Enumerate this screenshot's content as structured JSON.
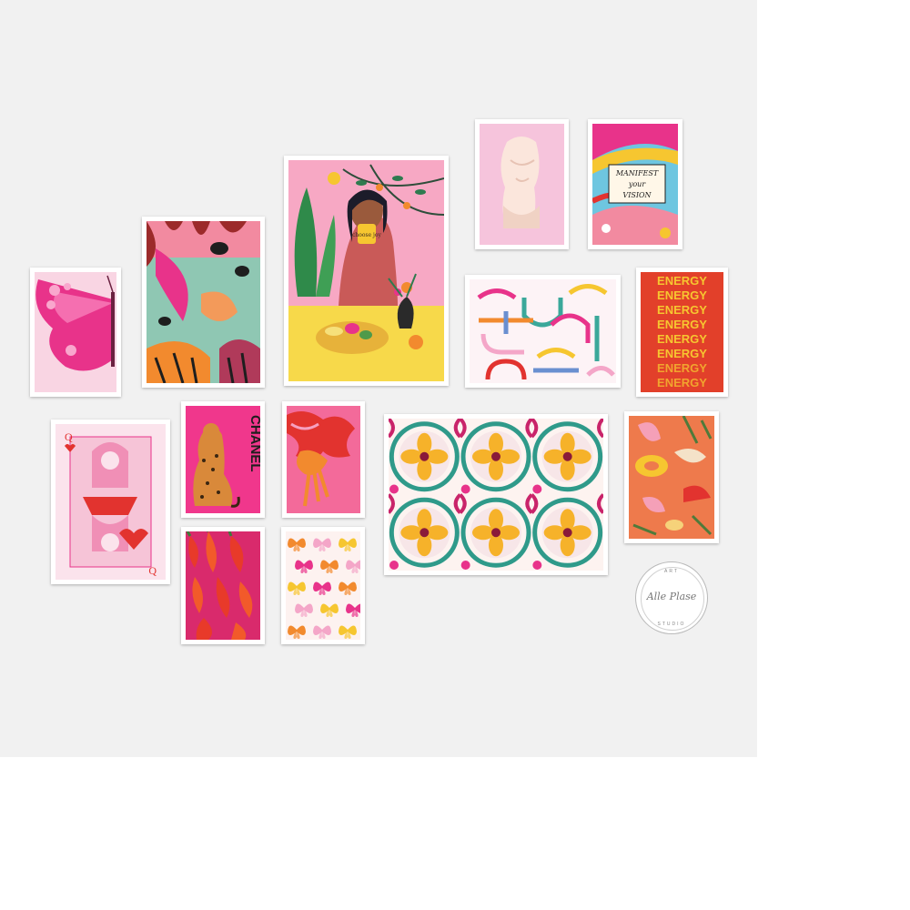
{
  "image": {
    "description_free": true,
    "background": "#f1f1f1",
    "frame_color": "#ffffff"
  },
  "prints": {
    "chanel": {
      "text": "CHANEL"
    },
    "manifest": {
      "line1": "MANIFEST",
      "line2": "your",
      "line3": "VISION"
    },
    "energy": {
      "word": "ENERGY"
    },
    "woman_mug": {
      "text": "choose joy"
    }
  },
  "logo": {
    "top": "ART",
    "name": "Alle Plase",
    "bottom": "STUDIO"
  },
  "colors": {
    "hot_pink": "#e8338a",
    "pink": "#f4a6c8",
    "orange": "#f28a2e",
    "yellow": "#f6c630",
    "teal": "#3aa89a",
    "red": "#e2332f"
  }
}
